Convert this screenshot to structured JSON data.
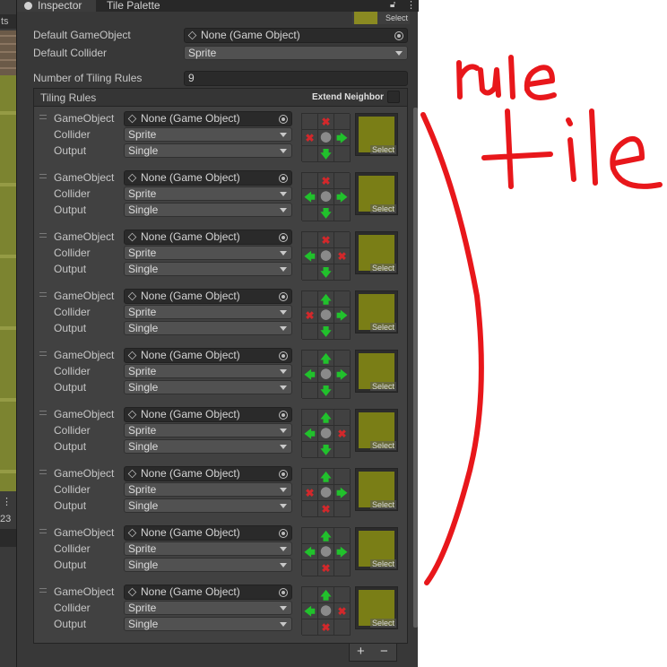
{
  "left_strip": {
    "label": "ts",
    "dots": "⋮",
    "count": "23"
  },
  "tabs": [
    {
      "label": "Inspector",
      "icon": "info-icon"
    },
    {
      "label": "Tile Palette"
    }
  ],
  "preview": {
    "select_label": "Select"
  },
  "defaults": {
    "gameobject_label": "Default GameObject",
    "gameobject_value": "None (Game Object)",
    "collider_label": "Default Collider",
    "collider_value": "Sprite"
  },
  "count_field": {
    "label": "Number of Tiling Rules",
    "value": "9"
  },
  "tiling_rules": {
    "title": "Tiling Rules",
    "extend_label": "Extend Neighbor",
    "field_labels": {
      "gameobject": "GameObject",
      "collider": "Collider",
      "output": "Output"
    },
    "select_label": "Select",
    "rules": [
      {
        "gameobject": "None (Game Object)",
        "collider": "Sprite",
        "output": "Single",
        "grid": [
          "",
          "x",
          "",
          "x",
          "c",
          "right",
          "",
          "down",
          ""
        ]
      },
      {
        "gameobject": "None (Game Object)",
        "collider": "Sprite",
        "output": "Single",
        "grid": [
          "",
          "x",
          "",
          "left",
          "c",
          "right",
          "",
          "down",
          ""
        ]
      },
      {
        "gameobject": "None (Game Object)",
        "collider": "Sprite",
        "output": "Single",
        "grid": [
          "",
          "x",
          "",
          "left",
          "c",
          "x",
          "",
          "down",
          ""
        ]
      },
      {
        "gameobject": "None (Game Object)",
        "collider": "Sprite",
        "output": "Single",
        "grid": [
          "",
          "up",
          "",
          "x",
          "c",
          "right",
          "",
          "down",
          ""
        ]
      },
      {
        "gameobject": "None (Game Object)",
        "collider": "Sprite",
        "output": "Single",
        "grid": [
          "",
          "up",
          "",
          "left",
          "c",
          "right",
          "",
          "down",
          ""
        ]
      },
      {
        "gameobject": "None (Game Object)",
        "collider": "Sprite",
        "output": "Single",
        "grid": [
          "",
          "up",
          "",
          "left",
          "c",
          "x",
          "",
          "down",
          ""
        ]
      },
      {
        "gameobject": "None (Game Object)",
        "collider": "Sprite",
        "output": "Single",
        "grid": [
          "",
          "up",
          "",
          "x",
          "c",
          "right",
          "",
          "x",
          ""
        ]
      },
      {
        "gameobject": "None (Game Object)",
        "collider": "Sprite",
        "output": "Single",
        "grid": [
          "",
          "up",
          "",
          "left",
          "c",
          "right",
          "",
          "x",
          ""
        ]
      },
      {
        "gameobject": "None (Game Object)",
        "collider": "Sprite",
        "output": "Single",
        "grid": [
          "",
          "up",
          "",
          "left",
          "c",
          "x",
          "",
          "x",
          ""
        ]
      }
    ]
  },
  "list_controls": {
    "add": "+",
    "remove": "−"
  },
  "annotation": {
    "line1": "rule",
    "line2": "tile",
    "color": "#e8171b"
  }
}
